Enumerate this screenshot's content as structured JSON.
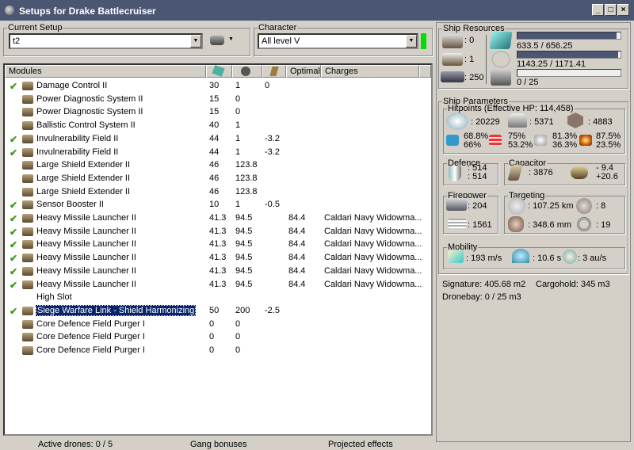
{
  "window": {
    "title": "Setups for Drake Battlecruiser"
  },
  "setup": {
    "label": "Current Setup",
    "value": "t2"
  },
  "character": {
    "label": "Character",
    "value": "All level V",
    "status_color": "#00e000"
  },
  "table": {
    "headers": [
      "Modules",
      "cpu-icon",
      "powergrid-icon",
      "capacitor-icon",
      "Optimal",
      "Charges"
    ],
    "rows": [
      {
        "checked": true,
        "name": "Damage Control II",
        "cpu": "30",
        "pg": "1",
        "cap": "0",
        "optimal": "",
        "charges": ""
      },
      {
        "checked": false,
        "name": "Power Diagnostic System II",
        "cpu": "15",
        "pg": "0",
        "cap": "",
        "optimal": "",
        "charges": ""
      },
      {
        "checked": false,
        "name": "Power Diagnostic System II",
        "cpu": "15",
        "pg": "0",
        "cap": "",
        "optimal": "",
        "charges": ""
      },
      {
        "checked": false,
        "name": "Ballistic Control System II",
        "cpu": "40",
        "pg": "1",
        "cap": "",
        "optimal": "",
        "charges": ""
      },
      {
        "checked": true,
        "name": "Invulnerability Field II",
        "cpu": "44",
        "pg": "1",
        "cap": "-3.2",
        "optimal": "",
        "charges": ""
      },
      {
        "checked": true,
        "name": "Invulnerability Field II",
        "cpu": "44",
        "pg": "1",
        "cap": "-3.2",
        "optimal": "",
        "charges": ""
      },
      {
        "checked": false,
        "name": "Large Shield Extender II",
        "cpu": "46",
        "pg": "123.8",
        "cap": "",
        "optimal": "",
        "charges": ""
      },
      {
        "checked": false,
        "name": "Large Shield Extender II",
        "cpu": "46",
        "pg": "123.8",
        "cap": "",
        "optimal": "",
        "charges": ""
      },
      {
        "checked": false,
        "name": "Large Shield Extender II",
        "cpu": "46",
        "pg": "123.8",
        "cap": "",
        "optimal": "",
        "charges": ""
      },
      {
        "checked": true,
        "name": "Sensor Booster II",
        "cpu": "10",
        "pg": "1",
        "cap": "-0.5",
        "optimal": "",
        "charges": ""
      },
      {
        "checked": true,
        "name": "Heavy Missile Launcher II",
        "cpu": "41.3",
        "pg": "94.5",
        "cap": "",
        "optimal": "84.4",
        "charges": "Caldari Navy Widowma..."
      },
      {
        "checked": true,
        "name": "Heavy Missile Launcher II",
        "cpu": "41.3",
        "pg": "94.5",
        "cap": "",
        "optimal": "84.4",
        "charges": "Caldari Navy Widowma..."
      },
      {
        "checked": true,
        "name": "Heavy Missile Launcher II",
        "cpu": "41.3",
        "pg": "94.5",
        "cap": "",
        "optimal": "84.4",
        "charges": "Caldari Navy Widowma..."
      },
      {
        "checked": true,
        "name": "Heavy Missile Launcher II",
        "cpu": "41.3",
        "pg": "94.5",
        "cap": "",
        "optimal": "84.4",
        "charges": "Caldari Navy Widowma..."
      },
      {
        "checked": true,
        "name": "Heavy Missile Launcher II",
        "cpu": "41.3",
        "pg": "94.5",
        "cap": "",
        "optimal": "84.4",
        "charges": "Caldari Navy Widowma..."
      },
      {
        "checked": true,
        "name": "Heavy Missile Launcher II",
        "cpu": "41.3",
        "pg": "94.5",
        "cap": "",
        "optimal": "84.4",
        "charges": "Caldari Navy Widowma..."
      },
      {
        "checked": false,
        "empty": true,
        "name": "High Slot",
        "cpu": "",
        "pg": "",
        "cap": "",
        "optimal": "",
        "charges": ""
      },
      {
        "checked": true,
        "selected": true,
        "name": "Siege Warfare Link - Shield Harmonizing",
        "cpu": "50",
        "pg": "200",
        "cap": "-2.5",
        "optimal": "",
        "charges": ""
      },
      {
        "checked": false,
        "name": "Core Defence Field Purger I",
        "cpu": "0",
        "pg": "0",
        "cap": "",
        "optimal": "",
        "charges": ""
      },
      {
        "checked": false,
        "name": "Core Defence Field Purger I",
        "cpu": "0",
        "pg": "0",
        "cap": "",
        "optimal": "",
        "charges": ""
      },
      {
        "checked": false,
        "name": "Core Defence Field Purger I",
        "cpu": "0",
        "pg": "0",
        "cap": "",
        "optimal": "",
        "charges": ""
      }
    ]
  },
  "status": {
    "drones": "Active drones: 0 / 5",
    "gang": "Gang bonuses",
    "projected": "Projected effects"
  },
  "resources": {
    "label": "Ship Resources",
    "turrets": ": 0",
    "launchers": ": 1",
    "drone_bay": ": 250",
    "cpu": {
      "text": "633.5 / 656.25",
      "fraction": 0.965
    },
    "powergrid": {
      "text": "1143.25 / 1171.41",
      "fraction": 0.976
    },
    "calibration": {
      "text": "0 / 25",
      "fraction": 0
    }
  },
  "params": {
    "label": "Ship Parameters",
    "hitpoints": {
      "label": "Hitpoints (Effective HP: 114,458)",
      "shield": ": 20229",
      "armor": ": 5371",
      "structure": ": 4883",
      "resists": [
        {
          "a": "68.8%",
          "b": "66%"
        },
        {
          "a": "75%",
          "b": "53.2%"
        },
        {
          "a": "81.3%",
          "b": "36.3%"
        },
        {
          "a": "87.5%",
          "b": "23.5%"
        }
      ]
    },
    "defence": {
      "label": "Defence",
      "a": ": 514",
      "b": ": 514"
    },
    "capacitor": {
      "label": "Capacitor",
      "capacity": ": 3876",
      "use": "- 9.4",
      "recharge": "+20.6"
    },
    "firepower": {
      "label": "Firepower",
      "a": ": 204",
      "b": ": 1561"
    },
    "targeting": {
      "label": "Targeting",
      "range": ": 107.25 km",
      "targets": ": 8",
      "resolution": ": 348.6 mm",
      "sensor": ": 19"
    },
    "mobility": {
      "label": "Mobility",
      "speed": ": 193 m/s",
      "align": ": 10.6 s",
      "warp": ": 3 au/s"
    },
    "signature": "Signature: 405.68 m2",
    "cargohold": "Cargohold: 345 m3",
    "dronebay": "Dronebay: 0 / 25 m3"
  }
}
